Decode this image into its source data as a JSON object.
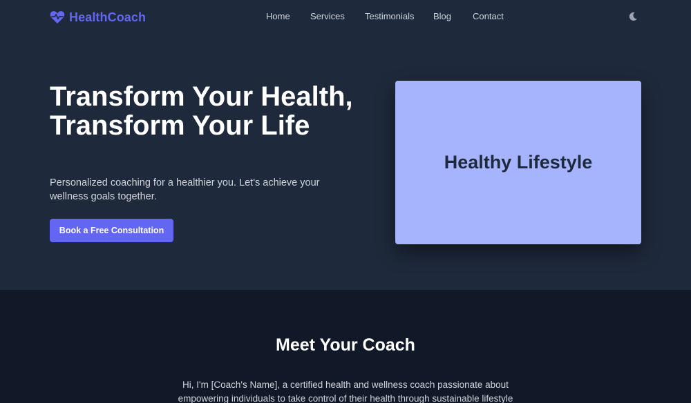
{
  "brand": {
    "name": "HealthCoach",
    "icon": "heart-pulse-icon",
    "color": "#6366f1"
  },
  "nav": {
    "items": [
      {
        "label": "Home"
      },
      {
        "label": "Services"
      },
      {
        "label": "Testimonials"
      },
      {
        "label": "Blog"
      },
      {
        "label": "Contact"
      }
    ],
    "theme_toggle_icon": "moon-icon"
  },
  "hero": {
    "title": "Transform Your Health, Transform Your Life",
    "subtitle": "Personalized coaching for a healthier you. Let's achieve your wellness goals together.",
    "cta_label": "Book a Free Consultation",
    "image_label": "Healthy Lifestyle",
    "image_bg": "#a5b4fc"
  },
  "about": {
    "title": "Meet Your Coach",
    "text": "Hi, I'm [Coach's Name], a certified health and wellness coach passionate about empowering individuals to take control of their health through sustainable lifestyle"
  },
  "colors": {
    "accent": "#6366f1",
    "background": "#1e293b",
    "section_dark": "#111827"
  }
}
